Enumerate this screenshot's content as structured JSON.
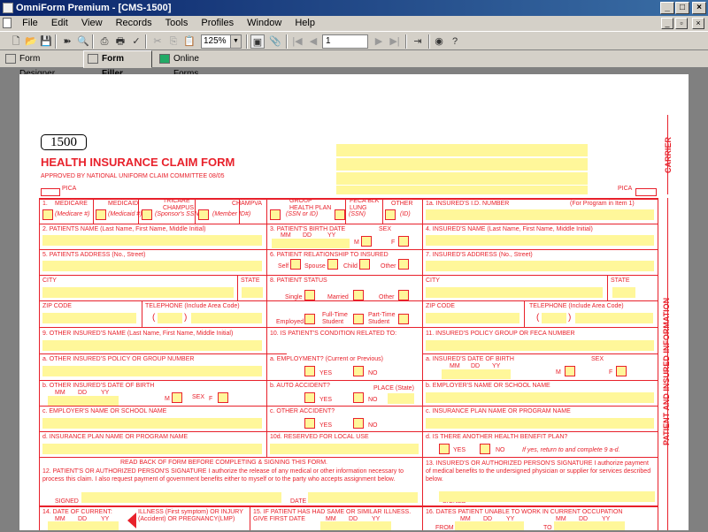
{
  "window": {
    "title": "OmniForm Premium - [CMS-1500]",
    "min": "_",
    "max": "□",
    "close": "×"
  },
  "menu": [
    "File",
    "Edit",
    "View",
    "Records",
    "Tools",
    "Profiles",
    "Window",
    "Help"
  ],
  "toolbar": {
    "zoom": "125%",
    "page": "1"
  },
  "tabs": [
    "Form Designer",
    "Form Filler",
    "Online Forms"
  ],
  "form": {
    "number": "1500",
    "title": "HEALTH INSURANCE CLAIM FORM",
    "approved": "APPROVED BY NATIONAL UNIFORM CLAIM COMMITTEE 08/05",
    "pica_left": "PICA",
    "pica_right": "PICA",
    "carrier": "CARRIER",
    "patient_info": "PATIENT AND INSURED INFORMATION",
    "f1": "1.",
    "medicare": "MEDICARE",
    "medicaid": "MEDICAID",
    "tricare": "TRICARE CHAMPUS",
    "champva": "CHAMPVA",
    "group": "GROUP HEALTH PLAN",
    "feca": "FECA BLK LUNG",
    "other": "OTHER",
    "medicare_n": "(Medicare #)",
    "medicaid_n": "(Medicaid #)",
    "sponsor_n": "(Sponsor's SSN)",
    "member_n": "(Member ID#)",
    "group_n": "(SSN or ID)",
    "feca_n": "(SSN)",
    "other_n": "(ID)",
    "f1a": "1a. INSURED'S I.D. NUMBER",
    "f1a_note": "(For Program in Item 1)",
    "f2": "2. PATIENTS NAME (Last Name, First Name, Middle Initial)",
    "f3": "3. PATIENT'S BIRTH DATE",
    "sex": "SEX",
    "mm": "MM",
    "dd": "DD",
    "yy": "YY",
    "m": "M",
    "f": "F",
    "f4": "4. INSURED'S NAME (Last Name, First Name, Middle Initial)",
    "f5": "5. PATIENTS ADDRESS (No., Street)",
    "f6": "6. PATIENT RELATIONSHIP TO INSURED",
    "self": "Self",
    "spouse": "Spouse",
    "child": "Child",
    "other2": "Other",
    "f7": "7. INSURED'S ADDRESS (No., Street)",
    "city": "CITY",
    "state": "STATE",
    "f8": "8. PATIENT STATUS",
    "single": "Single",
    "married": "Married",
    "other3": "Other",
    "zip": "ZIP CODE",
    "tel": "TELEPHONE (Include Area Code)",
    "employed": "Employed",
    "fulltime": "Full-Time Student",
    "parttime": "Part-Time Student",
    "paren_l": "(",
    "paren_r": ")",
    "dash": "–",
    "f9": "9. OTHER INSURED'S NAME (Last Name, First Name, Middle Initial)",
    "f10": "10. IS PATIENT'S CONDITION RELATED TO:",
    "f11": "11. INSURED'S POLICY GROUP OR FECA NUMBER",
    "f9a": "a. OTHER INSURED'S POLICY OR GROUP NUMBER",
    "f10a": "a. EMPLOYMENT? (Current or Previous)",
    "f11a": "a. INSURED'S DATE OF BIRTH",
    "yes": "YES",
    "no": "NO",
    "f9b": "b. OTHER INSURED'S DATE OF BIRTH",
    "f10b": "b. AUTO ACCIDENT?",
    "place": "PLACE (State)",
    "f11b": "b. EMPLOYER'S NAME OR SCHOOL NAME",
    "f9c": "c. EMPLOYER'S NAME OR SCHOOL NAME",
    "f10c": "c. OTHER ACCIDENT?",
    "f11c": "c. INSURANCE PLAN NAME OR PROGRAM NAME",
    "f9d": "d. INSURANCE PLAN NAME OR PROGRAM NAME",
    "f10d": "10d. RESERVED FOR LOCAL USE",
    "f11d": "d. IS THERE ANOTHER HEALTH BENEFIT PLAN?",
    "f11d_note": "If yes, return to and complete 9 a-d.",
    "readback": "READ BACK OF FORM BEFORE COMPLETING & SIGNING THIS FORM.",
    "f12": "12. PATIENT'S OR AUTHORIZED PERSON'S SIGNATURE I authorize the release of any medical or other information necessary to process this claim. I also request payment of government benefits either to myself or to the party who accepts assignment below.",
    "signed": "SIGNED",
    "date": "DATE",
    "f13": "13. INSURED'S OR AUTHORIZED PERSON'S SIGNATURE I authorize payment of medical benefits to the undersigned physician or supplier for services described below.",
    "f14": "14. DATE OF CURRENT:",
    "f14b": "ILLNESS (First symptom) OR INJURY (Accident) OR PREGNANCY(LMP)",
    "f15": "15. IF PATIENT HAS HAD SAME OR SIMILAR ILLNESS. GIVE FIRST DATE",
    "f16": "16. DATES PATIENT UNABLE TO WORK IN CURRENT OCCUPATION",
    "from": "FROM",
    "to": "TO"
  }
}
